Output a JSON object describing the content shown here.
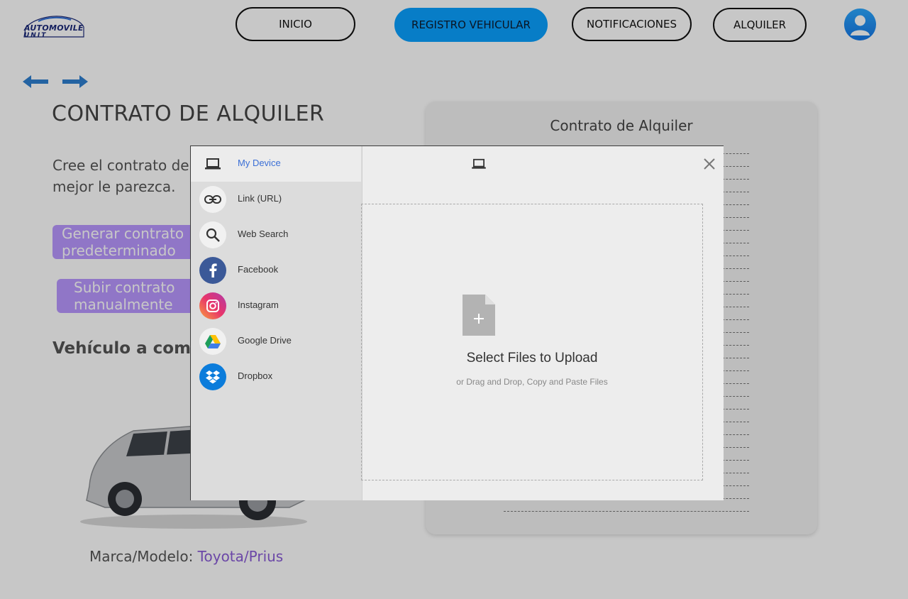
{
  "header": {
    "logo_line1": "AUTOMOVILE",
    "logo_line2": "UNIT",
    "nav": [
      {
        "label": "INICIO"
      },
      {
        "label": "REGISTRO VEHICULAR"
      },
      {
        "label": "NOTIFICACIONES"
      },
      {
        "label": "ALQUILER"
      }
    ],
    "active_nav": "REGISTRO VEHICULAR",
    "accent_color": "#0aa0ff"
  },
  "page": {
    "title": "CONTRATO DE ALQUILER",
    "description": "Cree el contrato de alquiler o suba el que mejor le parezca.",
    "generate_button": "Generar contrato predeterminado",
    "upload_button": "Subir contrato manualmente",
    "vehicle_section_title": "Vehículo a comprometer",
    "brand_label": "Marca/Modelo:",
    "brand_value": "Toyota/Prius",
    "button_color": "#b998ff"
  },
  "contract_card": {
    "title": "Contrato de Alquiler"
  },
  "upload_modal": {
    "sources": [
      {
        "label": "My Device",
        "icon": "laptop-icon"
      },
      {
        "label": "Link (URL)",
        "icon": "link-icon"
      },
      {
        "label": "Web Search",
        "icon": "search-icon"
      },
      {
        "label": "Facebook",
        "icon": "facebook-icon"
      },
      {
        "label": "Instagram",
        "icon": "instagram-icon"
      },
      {
        "label": "Google Drive",
        "icon": "google-drive-icon"
      },
      {
        "label": "Dropbox",
        "icon": "dropbox-icon"
      }
    ],
    "active_source": "My Device",
    "drop_title": "Select Files to Upload",
    "drop_subtitle": "or Drag and Drop, Copy and Paste Files"
  }
}
